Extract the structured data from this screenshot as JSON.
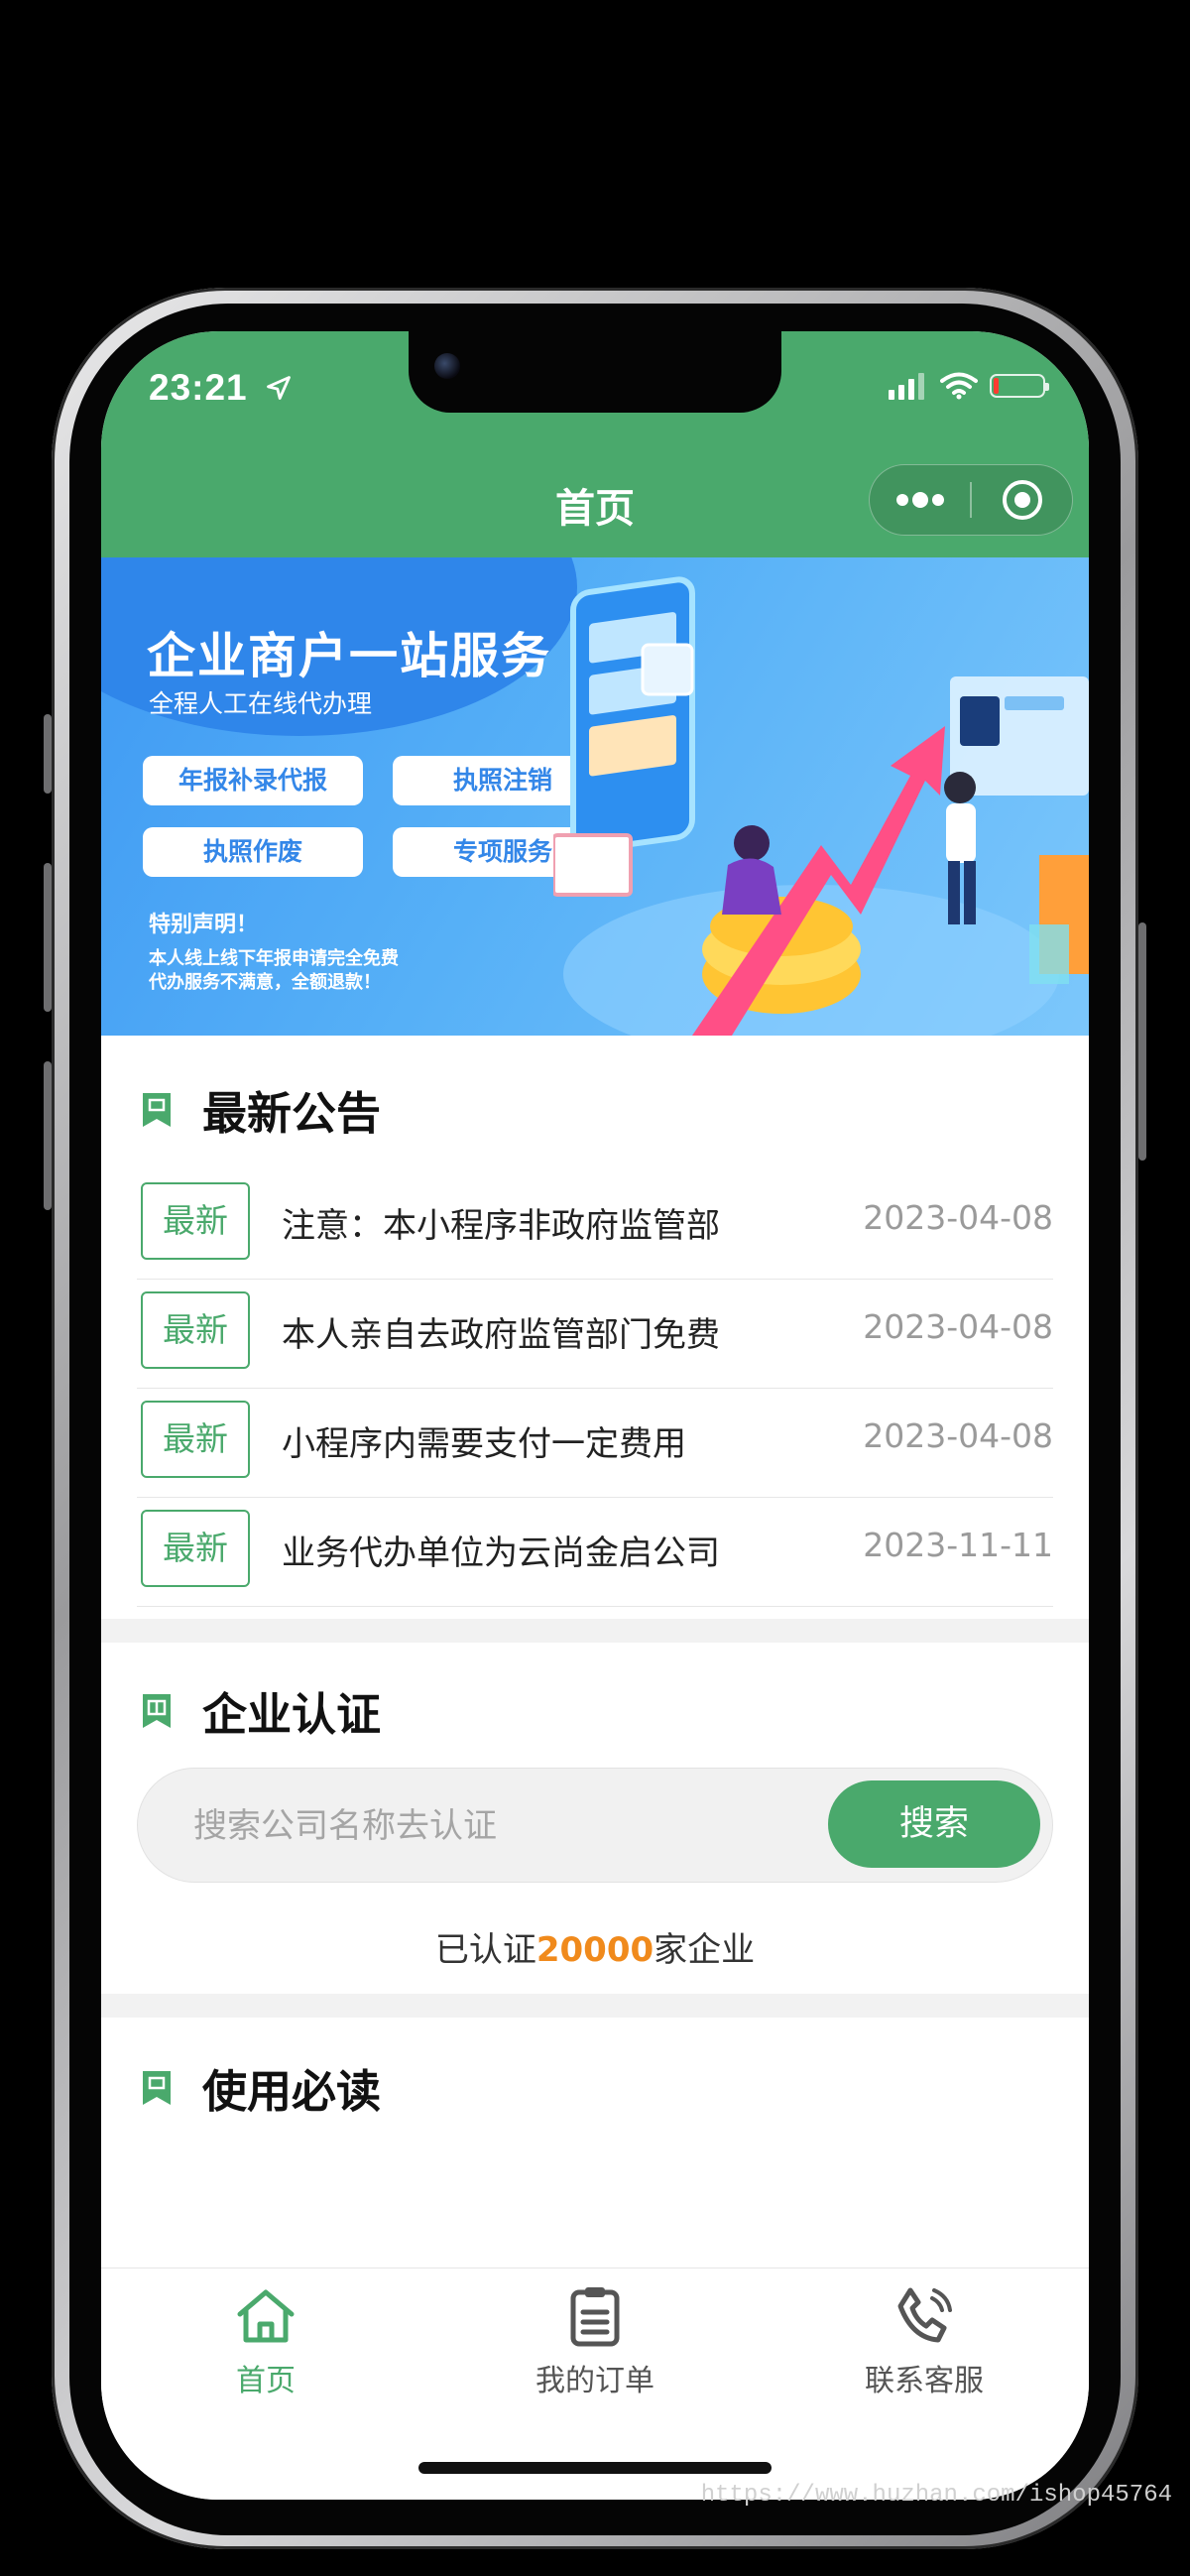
{
  "status": {
    "time": "23:21"
  },
  "nav": {
    "title": "首页"
  },
  "banner": {
    "title": "企业商户一站服务",
    "subtitle": "全程人工在线代办理",
    "chips": [
      "年报补录代报",
      "执照注销",
      "执照作废",
      "专项服务"
    ],
    "notice_title": "特别声明！",
    "notice_lines": [
      "本人线上线下年报申请完全免费",
      "代办服务不满意，全额退款！"
    ]
  },
  "announcements": {
    "title": "最新公告",
    "items": [
      {
        "badge": "最新",
        "text": "注意：本小程序非政府监管部",
        "date": "2023-04-08"
      },
      {
        "badge": "最新",
        "text": "本人亲自去政府监管部门免费",
        "date": "2023-04-08"
      },
      {
        "badge": "最新",
        "text": "小程序内需要支付一定费用",
        "date": "2023-04-08"
      },
      {
        "badge": "最新",
        "text": "业务代办单位为云尚金启公司",
        "date": "2023-11-11"
      }
    ]
  },
  "certification": {
    "title": "企业认证",
    "search_placeholder": "搜索公司名称去认证",
    "search_button": "搜索",
    "count_prefix": "已认证",
    "count": "20000",
    "count_suffix": "家企业"
  },
  "guide": {
    "title": "使用必读"
  },
  "tabbar": {
    "items": [
      {
        "label": "首页",
        "icon": "home-icon",
        "active": true
      },
      {
        "label": "我的订单",
        "icon": "clipboard-icon",
        "active": false
      },
      {
        "label": "联系客服",
        "icon": "phone-call-icon",
        "active": false
      }
    ]
  },
  "colors": {
    "primary": "#4aa96c",
    "accent": "#f08a1c",
    "banner": "#3f9af3"
  },
  "watermark": "https://www.huzhan.com/ishop45764"
}
